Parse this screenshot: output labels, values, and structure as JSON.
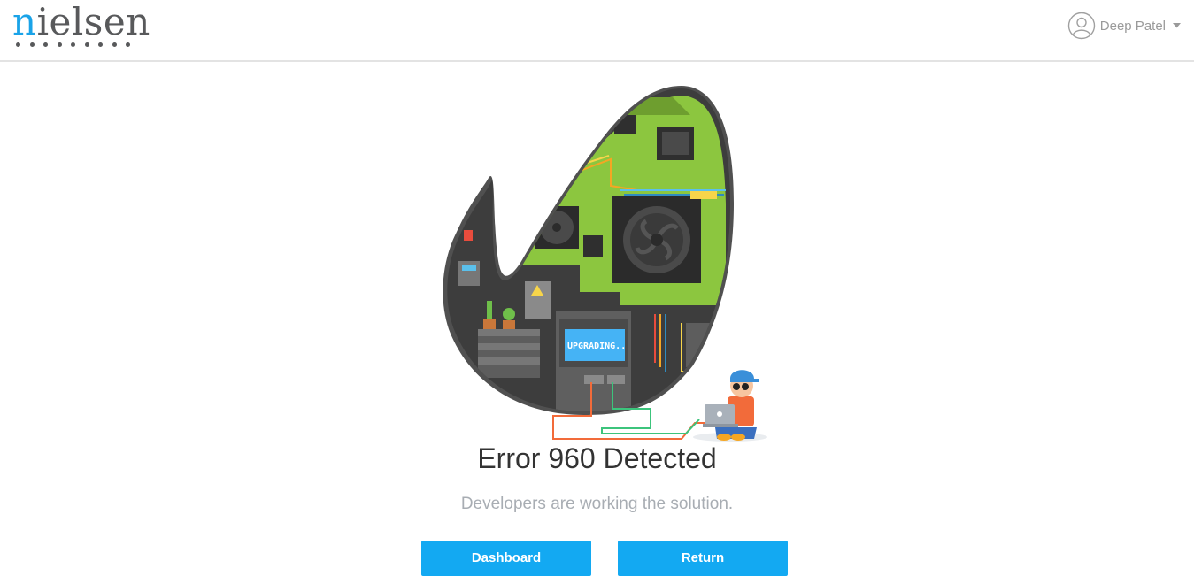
{
  "header": {
    "logo_text_accent": "n",
    "logo_text_rest": "ielsen",
    "user_name": "Deep Patel"
  },
  "illustration": {
    "screen_text": "UPGRADING.."
  },
  "error": {
    "title": "Error 960 Detected",
    "subtitle": "Developers are working the solution."
  },
  "buttons": {
    "dashboard_label": "Dashboard",
    "return_label": "Return"
  },
  "colors": {
    "accent": "#13a9f2",
    "logo_blue": "#1aa3e8",
    "board_green": "#8cc63f",
    "shell_dark": "#4a4a4a"
  },
  "icons": [
    "user-avatar-icon",
    "caret-down-icon"
  ]
}
